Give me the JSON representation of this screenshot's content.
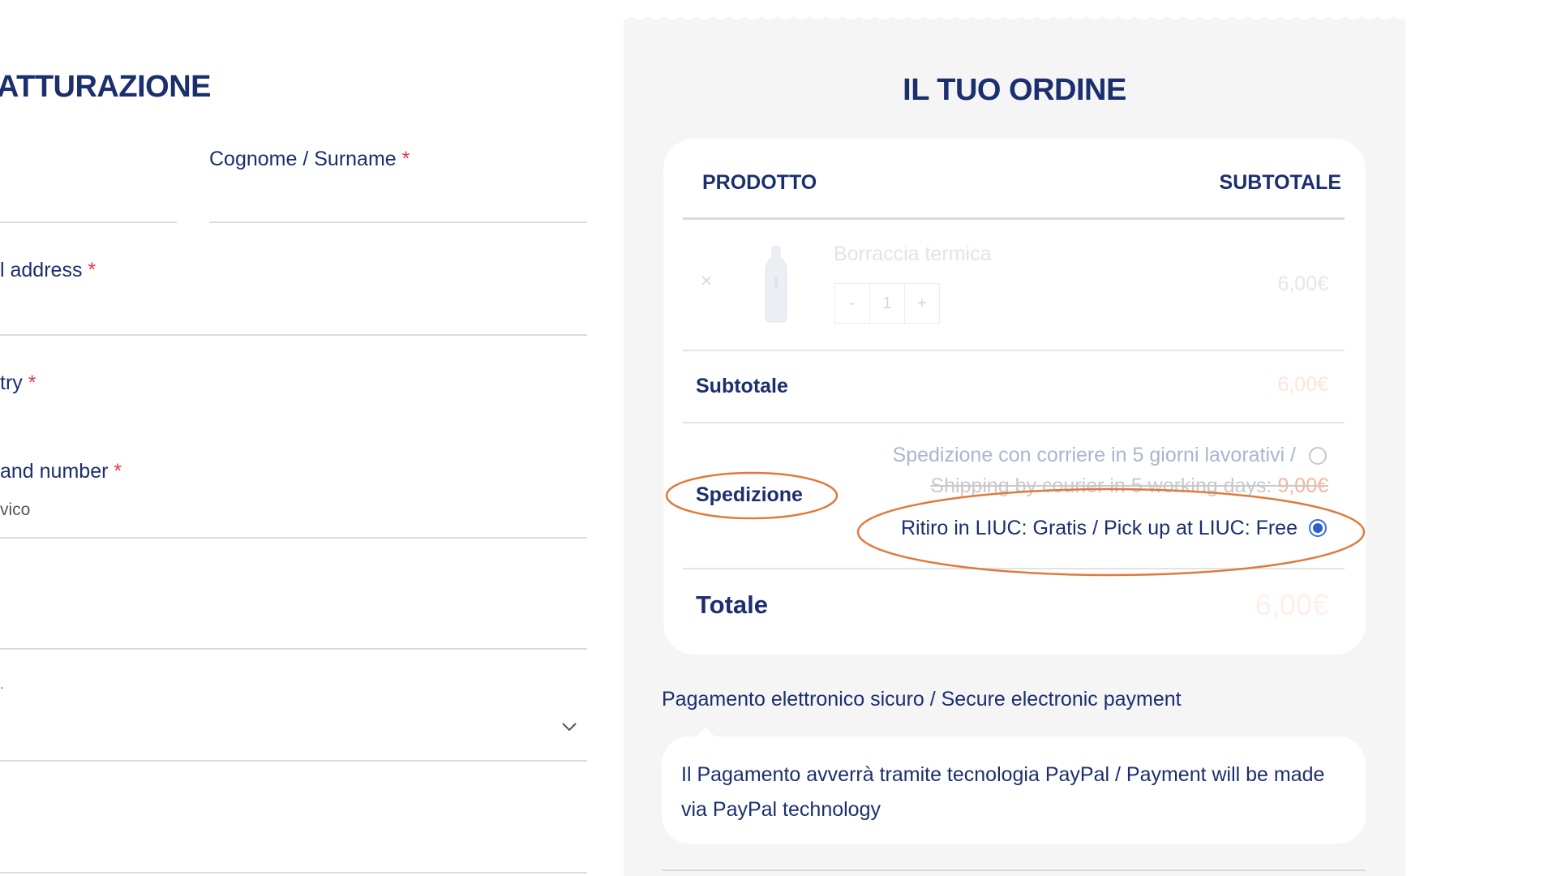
{
  "billing": {
    "title": "ATTURAZIONE",
    "fields": {
      "surname_label": "Cognome / Surname",
      "email_label": "l address",
      "country_label": "try",
      "street_label": " and number",
      "street_placeholder": "vico",
      "state_label": "."
    },
    "required_mark": "*"
  },
  "order": {
    "title": "IL TUO ORDINE",
    "headers": {
      "product": "PRODOTTO",
      "subtotal": "SUBTOTALE"
    },
    "item": {
      "remove": "×",
      "name": "Borraccia termica",
      "qty_minus": "-",
      "qty": "1",
      "qty_plus": "+",
      "price": "6,00€"
    },
    "subtotal": {
      "label": "Subtotale",
      "value": "6,00€"
    },
    "shipping": {
      "label": "Spedizione",
      "option1_line1": "Spedizione con corriere in 5 giorni lavorativi /",
      "option1_line2": "Shipping by courier in 5 working days: ",
      "option1_price": "9,00€",
      "option2": "Ritiro in LIUC: Gratis / Pick up at LIUC: Free",
      "selected": "option2"
    },
    "total": {
      "label": "Totale",
      "value": "6,00€"
    }
  },
  "payment": {
    "title": "Pagamento elettronico sicuro / Secure electronic payment",
    "description": "Il Pagamento avverrà tramite tecnologia PayPal / Payment will be made via PayPal technology"
  },
  "colors": {
    "text_primary": "#1b2f6e",
    "required": "#e2374a",
    "annotation": "#e07a3c",
    "radio_selected": "#2b5fd1",
    "panel_bg": "#f5f5f5"
  }
}
